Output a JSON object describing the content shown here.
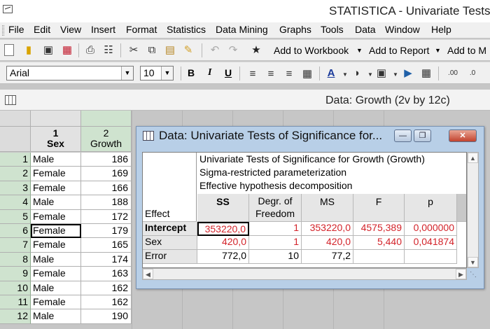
{
  "window": {
    "title": "STATISTICA - Univariate Tests o"
  },
  "menu": [
    "File",
    "Edit",
    "View",
    "Insert",
    "Format",
    "Statistics",
    "Data Mining",
    "Graphs",
    "Tools",
    "Data",
    "Window",
    "Help"
  ],
  "toolbar": {
    "add_to_workbook": "Add to Workbook",
    "add_to_report": "Add to Report",
    "add_to_ms": "Add to M"
  },
  "format_bar": {
    "font": "Arial",
    "size": "10",
    "bold": "B",
    "italic": "I",
    "underline": "U"
  },
  "data_window": {
    "title": "Data: Growth (2v by 12c)"
  },
  "spreadsheet": {
    "col1_num": "1",
    "col1_name": "Sex",
    "col2_num": "2",
    "col2_name": "Growth",
    "rows": [
      {
        "n": "1",
        "sex": "Male",
        "growth": "186"
      },
      {
        "n": "2",
        "sex": "Female",
        "growth": "169"
      },
      {
        "n": "3",
        "sex": "Female",
        "growth": "166"
      },
      {
        "n": "4",
        "sex": "Male",
        "growth": "188"
      },
      {
        "n": "5",
        "sex": "Female",
        "growth": "172"
      },
      {
        "n": "6",
        "sex": "Female",
        "growth": "179"
      },
      {
        "n": "7",
        "sex": "Female",
        "growth": "165"
      },
      {
        "n": "8",
        "sex": "Male",
        "growth": "174"
      },
      {
        "n": "9",
        "sex": "Female",
        "growth": "163"
      },
      {
        "n": "10",
        "sex": "Male",
        "growth": "162"
      },
      {
        "n": "11",
        "sex": "Female",
        "growth": "162"
      },
      {
        "n": "12",
        "sex": "Male",
        "growth": "190"
      }
    ]
  },
  "dialog": {
    "title": "Data: Univariate Tests of Significance for...",
    "header_lines": [
      "Univariate Tests of Significance for Growth (Growth)",
      "Sigma-restricted parameterization",
      "Effective hypothesis decomposition"
    ],
    "columns": {
      "effect": "Effect",
      "ss": "SS",
      "df_line1": "Degr. of",
      "df_line2": "Freedom",
      "ms": "MS",
      "f": "F",
      "p": "p"
    },
    "rows": [
      {
        "effect": "Intercept",
        "ss": "353220,0",
        "df": "1",
        "ms": "353220,0",
        "f": "4575,389",
        "p": "0,000000"
      },
      {
        "effect": "Sex",
        "ss": "420,0",
        "df": "1",
        "ms": "420,0",
        "f": "5,440",
        "p": "0,041874"
      },
      {
        "effect": "Error",
        "ss": "772,0",
        "df": "10",
        "ms": "77,2",
        "f": "",
        "p": ""
      }
    ]
  },
  "colors": {
    "significant": "#d3232a",
    "row_header": "#cfe3cf",
    "dialog_frame": "#b8cfe7"
  }
}
